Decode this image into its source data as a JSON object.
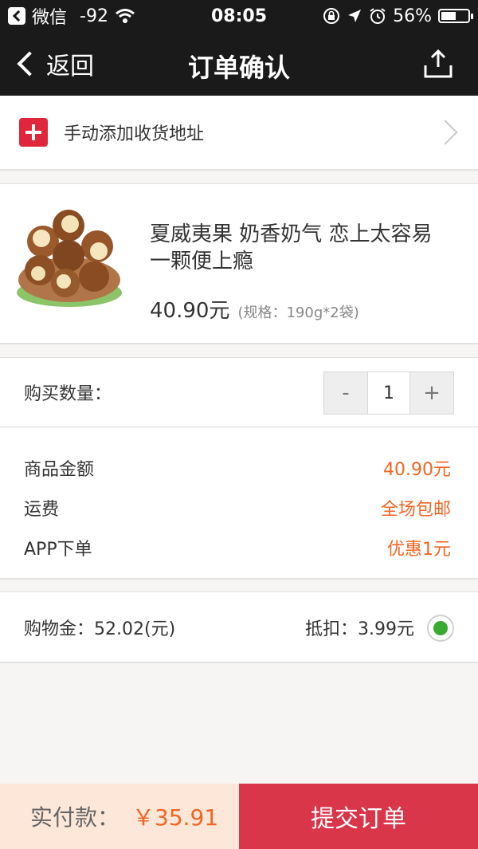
{
  "status_bar": {
    "carrier": "微信",
    "signal": "-92",
    "time": "08:05",
    "battery": "56%",
    "battery_level": 0.56
  },
  "nav": {
    "back_label": "返回",
    "title": "订单确认"
  },
  "address": {
    "label": "手动添加收货地址"
  },
  "product": {
    "title": "夏威夷果 奶香奶气 恋上太容易 一颗便上瘾",
    "price": "40.90元",
    "spec": "(规格：190g*2袋)"
  },
  "quantity": {
    "label": "购买数量：",
    "minus": "-",
    "value": "1",
    "plus": "+"
  },
  "amounts": {
    "rows": [
      {
        "label": "商品金额",
        "value": "40.90元"
      },
      {
        "label": "运费",
        "value": "全场包邮"
      },
      {
        "label": "APP下单",
        "value": "优惠1元"
      }
    ]
  },
  "coupon": {
    "balance": "购物金：52.02(元)",
    "deduct": "抵扣：3.99元",
    "selected": true
  },
  "footer": {
    "pay_label": "实付款：",
    "pay_value": "￥35.91",
    "submit_label": "提交订单"
  },
  "colors": {
    "accent": "#f26522",
    "submit": "#d9364a",
    "header": "#1a1a1a",
    "plus_badge": "#e0263a",
    "radio_on": "#3aa92f"
  }
}
